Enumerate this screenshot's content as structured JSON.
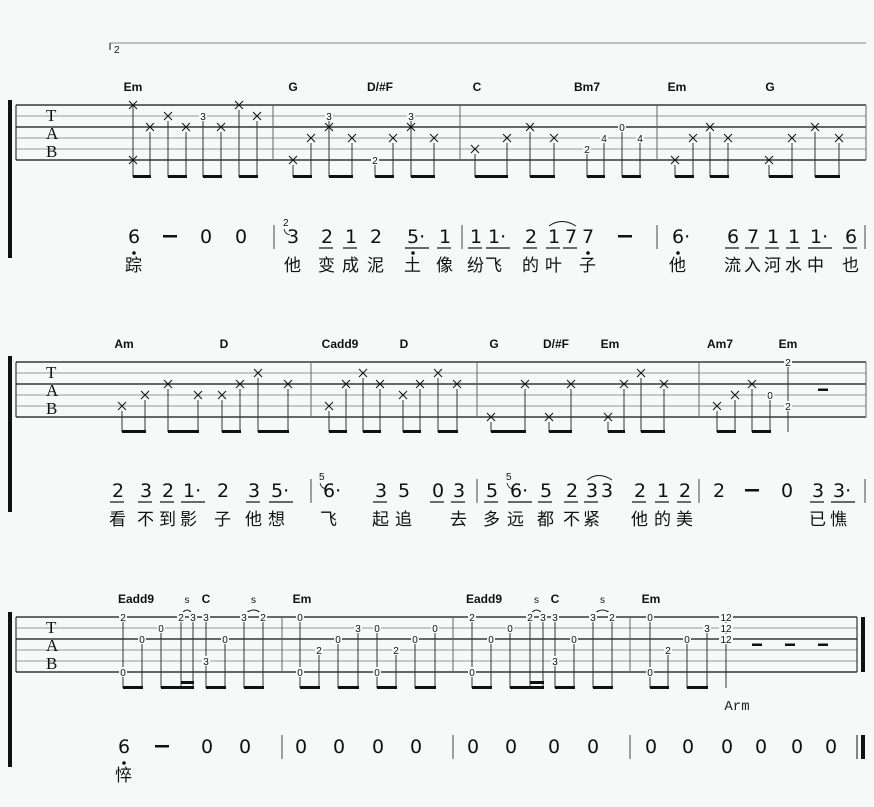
{
  "volta": "2",
  "tab_clef": [
    "T",
    "A",
    "B"
  ],
  "systems": [
    {
      "measures": [
        {
          "chords": [
            "Em"
          ],
          "tab": [
            [
              [
                1,
                "x"
              ],
              [
                6,
                "x"
              ]
            ],
            [
              [
                3,
                "x"
              ]
            ],
            [
              [
                2,
                "x"
              ]
            ],
            [
              [
                3,
                "x"
              ]
            ],
            [
              [
                2,
                "3"
              ]
            ],
            [
              [
                3,
                "x"
              ]
            ],
            [
              [
                1,
                "x"
              ]
            ],
            [
              [
                2,
                "x"
              ]
            ]
          ],
          "jianpu": [
            {
              "n": "6",
              "db": true,
              "lyric": "踪"
            },
            {
              "n": "–"
            },
            {
              "n": "0"
            },
            {
              "n": "0"
            }
          ]
        },
        {
          "chords": [
            "G",
            "D/#F"
          ],
          "tab": [
            [
              [
                6,
                "x"
              ]
            ],
            [
              [
                4,
                "x"
              ]
            ],
            [
              [
                2,
                "3"
              ],
              [
                3,
                "x"
              ]
            ],
            [
              [
                4,
                "x"
              ]
            ],
            [
              [
                6,
                "2"
              ]
            ],
            [
              [
                4,
                "x"
              ]
            ],
            [
              [
                2,
                "3"
              ],
              [
                3,
                "x"
              ]
            ],
            [
              [
                4,
                "x"
              ]
            ]
          ],
          "jianpu": [
            {
              "n": "3",
              "g": "2",
              "lyric": "他"
            },
            {
              "n": "2",
              "u": true,
              "lyric": "变"
            },
            {
              "n": "1",
              "u": true,
              "lyric": "成"
            },
            {
              "n": "2",
              "lyric": "泥"
            },
            {
              "n": "5·",
              "u": true,
              "db": true,
              "lyric": "土"
            },
            {
              "n": "1",
              "u": true,
              "lyric": "像"
            }
          ]
        },
        {
          "chords": [
            "C",
            "Bm7"
          ],
          "tab": [
            [
              [
                5,
                "x"
              ]
            ],
            [
              [
                4,
                "x"
              ]
            ],
            [
              [
                3,
                "x"
              ]
            ],
            [
              [
                4,
                "x"
              ]
            ],
            [
              [
                5,
                "2"
              ]
            ],
            [
              [
                4,
                "4"
              ]
            ],
            [
              [
                3,
                "0"
              ]
            ],
            [
              [
                4,
                "4"
              ]
            ]
          ],
          "jianpu": [
            {
              "n": "1",
              "u": true,
              "lyric": "纷"
            },
            {
              "n": "1·",
              "u": true,
              "lyric": "飞"
            },
            {
              "n": "2",
              "u": true,
              "lyric": "的"
            },
            {
              "n": "1",
              "u": true,
              "lyric": "叶"
            },
            {
              "n": "7",
              "u": true
            },
            {
              "n": "7",
              "db": true,
              "lyric": "子"
            },
            {
              "n": "–"
            }
          ]
        },
        {
          "chords": [
            "Em",
            "G"
          ],
          "tab": [
            [
              [
                6,
                "x"
              ]
            ],
            [
              [
                4,
                "x"
              ]
            ],
            [
              [
                3,
                "x"
              ]
            ],
            [
              [
                4,
                "x"
              ]
            ],
            [
              [
                6,
                "x"
              ]
            ],
            [
              [
                4,
                "x"
              ]
            ],
            [
              [
                3,
                "x"
              ]
            ],
            [
              [
                4,
                "x"
              ]
            ]
          ],
          "jianpu": [
            {
              "n": "6·",
              "db": true,
              "lyric": "他"
            },
            {
              "n": "6",
              "u": true,
              "lyric": "流"
            },
            {
              "n": "7",
              "u": true,
              "lyric": "入"
            },
            {
              "n": "1",
              "u": true,
              "lyric": "河"
            },
            {
              "n": "1",
              "u": true,
              "lyric": "水"
            },
            {
              "n": "1·",
              "u": true,
              "lyric": "中"
            },
            {
              "n": "6",
              "u": true,
              "lyric": "也"
            }
          ]
        }
      ]
    },
    {
      "measures": [
        {
          "chords": [
            "Am",
            "D"
          ],
          "tab": [
            [
              [
                5,
                "x"
              ]
            ],
            [
              [
                4,
                "x"
              ]
            ],
            [
              [
                3,
                "x"
              ]
            ],
            [
              [
                4,
                "x"
              ]
            ],
            [
              [
                4,
                "x"
              ]
            ],
            [
              [
                3,
                "x"
              ]
            ],
            [
              [
                2,
                "x"
              ]
            ],
            [
              [
                3,
                "x"
              ]
            ]
          ],
          "jianpu": [
            {
              "n": "2",
              "u": true,
              "lyric": "看"
            },
            {
              "n": "3",
              "u": true,
              "lyric": "不"
            },
            {
              "n": "2",
              "u": true,
              "lyric": "到"
            },
            {
              "n": "1·",
              "u": true,
              "lyric": "影"
            },
            {
              "n": "2",
              "lyric": "子"
            },
            {
              "n": "3",
              "u": true,
              "lyric": "他"
            },
            {
              "n": "5·",
              "u": true,
              "lyric": "想"
            }
          ]
        },
        {
          "chords": [
            "Cadd9",
            "D"
          ],
          "tab": [
            [
              [
                5,
                "x"
              ]
            ],
            [
              [
                3,
                "x"
              ]
            ],
            [
              [
                2,
                "x"
              ]
            ],
            [
              [
                3,
                "x"
              ]
            ],
            [
              [
                4,
                "x"
              ]
            ],
            [
              [
                3,
                "x"
              ]
            ],
            [
              [
                2,
                "x"
              ]
            ],
            [
              [
                3,
                "x"
              ]
            ]
          ],
          "jianpu": [
            {
              "n": "6·",
              "g": "5",
              "lyric": "飞"
            },
            {
              "n": "3",
              "u": true,
              "lyric": "起"
            },
            {
              "n": "5",
              "lyric": "追"
            },
            {
              "n": "0",
              "u": true
            },
            {
              "n": "3",
              "u": true,
              "lyric": "去"
            }
          ]
        },
        {
          "chords": [
            "G",
            "D/#F",
            "Em"
          ],
          "tab": [
            [
              [
                6,
                "x"
              ]
            ],
            [
              [
                3,
                "x"
              ]
            ],
            [
              [
                6,
                "x"
              ]
            ],
            [
              [
                3,
                "x"
              ]
            ],
            [
              [
                6,
                "x"
              ]
            ],
            [
              [
                3,
                "x"
              ]
            ],
            [
              [
                2,
                "x"
              ]
            ],
            [
              [
                3,
                "x"
              ]
            ]
          ],
          "jianpu": [
            {
              "n": "5",
              "u": true,
              "lyric": "多"
            },
            {
              "n": "6·",
              "u": true,
              "g": "5",
              "lyric": "远"
            },
            {
              "n": "5",
              "u": true,
              "lyric": "都"
            },
            {
              "n": "2",
              "u": true,
              "lyric": "不"
            },
            {
              "n": "3",
              "u": true,
              "lyric": "紧"
            },
            {
              "n": "3"
            },
            {
              "n": "2",
              "u": true,
              "lyric": "他"
            },
            {
              "n": "1",
              "u": true,
              "lyric": "的"
            },
            {
              "n": "2",
              "u": true,
              "lyric": "美"
            }
          ]
        },
        {
          "chords": [
            "Am7",
            "Em"
          ],
          "tab": [
            [
              [
                5,
                "x"
              ]
            ],
            [
              [
                4,
                "x"
              ]
            ],
            [
              [
                3,
                "x"
              ]
            ],
            [
              [
                4,
                "0"
              ]
            ],
            [
              [
                1,
                "2"
              ],
              [
                5,
                "2"
              ]
            ]
          ],
          "rests": 1,
          "jianpu": [
            {
              "n": "2"
            },
            {
              "n": "–"
            },
            {
              "n": "0"
            },
            {
              "n": "3",
              "u": true,
              "lyric": "已"
            },
            {
              "n": "3·",
              "u": true,
              "lyric": "憔"
            }
          ]
        }
      ]
    },
    {
      "measures": [
        {
          "chords": [
            "Eadd9",
            "C"
          ],
          "slides": [
            "s",
            "s"
          ],
          "tab": [
            [
              [
                1,
                "2"
              ],
              [
                6,
                "0"
              ]
            ],
            [
              [
                3,
                "0"
              ]
            ],
            [
              [
                2,
                "0"
              ]
            ],
            [
              [
                1,
                "2"
              ]
            ],
            [
              [
                1,
                "3"
              ]
            ],
            [
              [
                1,
                "3"
              ],
              [
                5,
                "3"
              ]
            ],
            [
              [
                3,
                "0"
              ]
            ],
            [
              [
                1,
                "3"
              ]
            ],
            [
              [
                1,
                "2"
              ]
            ]
          ],
          "jianpu": [
            {
              "n": "6",
              "db": true,
              "lyric": "悴"
            },
            {
              "n": "–"
            },
            {
              "n": "0"
            },
            {
              "n": "0"
            }
          ]
        },
        {
          "chords": [
            "Em"
          ],
          "tab": [
            [
              [
                1,
                "0"
              ],
              [
                6,
                "0"
              ]
            ],
            [
              [
                4,
                "2"
              ]
            ],
            [
              [
                3,
                "0"
              ]
            ],
            [
              [
                2,
                "3"
              ]
            ],
            [
              [
                2,
                "0"
              ],
              [
                6,
                "0"
              ]
            ],
            [
              [
                4,
                "2"
              ]
            ],
            [
              [
                3,
                "0"
              ]
            ],
            [
              [
                2,
                "0"
              ]
            ]
          ],
          "jianpu": [
            {
              "n": "0"
            },
            {
              "n": "0"
            },
            {
              "n": "0"
            },
            {
              "n": "0"
            }
          ]
        },
        {
          "chords": [
            "Eadd9",
            "C"
          ],
          "slides": [
            "s",
            "s"
          ],
          "tab": [
            [
              [
                1,
                "2"
              ],
              [
                6,
                "0"
              ]
            ],
            [
              [
                3,
                "0"
              ]
            ],
            [
              [
                2,
                "0"
              ]
            ],
            [
              [
                1,
                "2"
              ]
            ],
            [
              [
                1,
                "3"
              ]
            ],
            [
              [
                1,
                "3"
              ],
              [
                5,
                "3"
              ]
            ],
            [
              [
                3,
                "0"
              ]
            ],
            [
              [
                1,
                "3"
              ]
            ],
            [
              [
                1,
                "2"
              ]
            ]
          ],
          "jianpu": [
            {
              "n": "0"
            },
            {
              "n": "0"
            },
            {
              "n": "0"
            },
            {
              "n": "0"
            }
          ]
        },
        {
          "chords": [
            "Em"
          ],
          "tab": [
            [
              [
                1,
                "0"
              ],
              [
                6,
                "0"
              ]
            ],
            [
              [
                4,
                "2"
              ]
            ],
            [
              [
                3,
                "0"
              ]
            ],
            [
              [
                2,
                "3"
              ]
            ],
            [
              [
                1,
                "12"
              ],
              [
                2,
                "12"
              ],
              [
                3,
                "12"
              ]
            ]
          ],
          "rests": 3,
          "annotation": "Arm",
          "jianpu": [
            {
              "n": "0"
            },
            {
              "n": "0"
            },
            {
              "n": "0"
            },
            {
              "n": "0"
            },
            {
              "n": "0"
            },
            {
              "n": "0"
            }
          ]
        }
      ]
    }
  ]
}
